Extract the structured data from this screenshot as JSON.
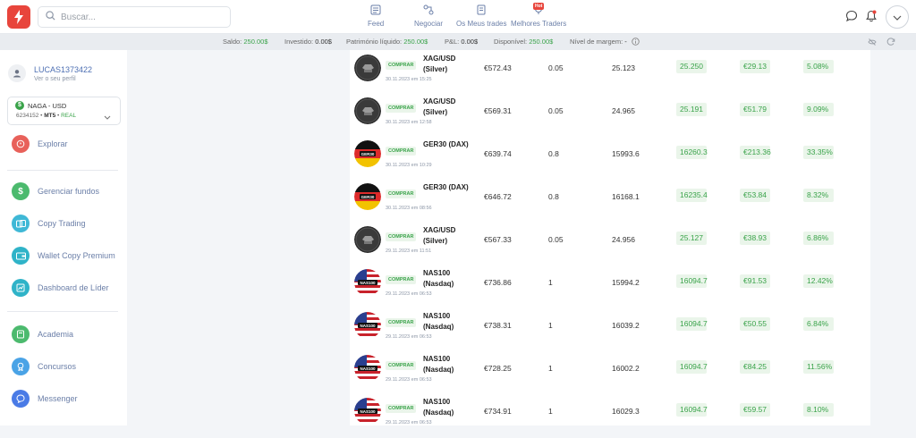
{
  "header": {
    "search_placeholder": "Buscar...",
    "nav": [
      {
        "label": "Feed",
        "icon": "feed-icon"
      },
      {
        "label": "Negociar",
        "icon": "trade-icon"
      },
      {
        "label": "Os Meus trades",
        "icon": "my-trades-icon"
      },
      {
        "label": "Melhores Traders",
        "icon": "trophy-icon",
        "badge": "Hot"
      }
    ]
  },
  "status": {
    "saldo_label": "Saldo:",
    "saldo_value": "250.00$",
    "investido_label": "Investido:",
    "investido_value": "0.00$",
    "patrimonio_label": "Património líquido:",
    "patrimonio_value": "250.00$",
    "pl_label": "P&L:",
    "pl_value": "0.00$",
    "disponivel_label": "Disponível:",
    "disponivel_value": "250.00$",
    "margem_label": "Nível de margem:",
    "margem_value": "-"
  },
  "profile": {
    "username": "LUCAS1373422",
    "sub": "Ver o seu perfil"
  },
  "account": {
    "title": "NAGA - USD",
    "number": "6234152",
    "platform": "MT5",
    "type": "REAL"
  },
  "sidebar": [
    {
      "label": "Explorar",
      "icon": "explore-icon",
      "color": "#e8615a"
    },
    {
      "label": "Gerenciar fundos",
      "icon": "dollar-icon",
      "color": "#4cba6e"
    },
    {
      "label": "Copy Trading",
      "icon": "copy-trading-icon",
      "color": "#3fb8d6"
    },
    {
      "label": "Wallet Copy Premium",
      "icon": "wallet-icon",
      "color": "#2fb3c8"
    },
    {
      "label": "Dashboard de Líder",
      "icon": "dashboard-icon",
      "color": "#2fb3c8"
    },
    {
      "label": "Academia",
      "icon": "academy-icon",
      "color": "#4cba6e"
    },
    {
      "label": "Concursos",
      "icon": "contest-icon",
      "color": "#4aa3e6"
    },
    {
      "label": "Messenger",
      "icon": "messenger-icon",
      "color": "#4a7be6"
    }
  ],
  "trades": [
    {
      "coin": "silver",
      "action": "COMPRAR",
      "instrument": "XAG/USD (Silver)",
      "date": "30.11.2023 em 15:25",
      "amount": "€572.43",
      "lots": "0.05",
      "open": "25.123",
      "current": "25.250",
      "profit": "€29.13",
      "pct": "5.08%"
    },
    {
      "coin": "silver",
      "action": "COMPRAR",
      "instrument": "XAG/USD (Silver)",
      "date": "30.11.2023 em 12:58",
      "amount": "€569.31",
      "lots": "0.05",
      "open": "24.965",
      "current": "25.191",
      "profit": "€51.79",
      "pct": "9.09%"
    },
    {
      "coin": "ger",
      "coin_label": "GER30",
      "action": "COMPRAR",
      "instrument": "GER30 (DAX)",
      "date": "30.11.2023 em 10:29",
      "amount": "€639.74",
      "lots": "0.8",
      "open": "15993.6",
      "current": "16260.3",
      "profit": "€213.36",
      "pct": "33.35%"
    },
    {
      "coin": "ger",
      "coin_label": "GER30",
      "action": "COMPRAR",
      "instrument": "GER30 (DAX)",
      "date": "30.11.2023 em 08:56",
      "amount": "€646.72",
      "lots": "0.8",
      "open": "16168.1",
      "current": "16235.4",
      "profit": "€53.84",
      "pct": "8.32%"
    },
    {
      "coin": "silver",
      "action": "COMPRAR",
      "instrument": "XAG/USD (Silver)",
      "date": "29.11.2023 em 11:51",
      "amount": "€567.33",
      "lots": "0.05",
      "open": "24.956",
      "current": "25.127",
      "profit": "€38.93",
      "pct": "6.86%"
    },
    {
      "coin": "us",
      "coin_label": "NAS100",
      "action": "COMPRAR",
      "instrument": "NAS100 (Nasdaq)",
      "date": "29.11.2023 em 06:53",
      "amount": "€736.86",
      "lots": "1",
      "open": "15994.2",
      "current": "16094.7",
      "profit": "€91.53",
      "pct": "12.42%"
    },
    {
      "coin": "us",
      "coin_label": "NAS100",
      "action": "COMPRAR",
      "instrument": "NAS100 (Nasdaq)",
      "date": "29.11.2023 em 06:53",
      "amount": "€738.31",
      "lots": "1",
      "open": "16039.2",
      "current": "16094.7",
      "profit": "€50.55",
      "pct": "6.84%"
    },
    {
      "coin": "us",
      "coin_label": "NAS100",
      "action": "COMPRAR",
      "instrument": "NAS100 (Nasdaq)",
      "date": "29.11.2023 em 06:53",
      "amount": "€728.25",
      "lots": "1",
      "open": "16002.2",
      "current": "16094.7",
      "profit": "€84.25",
      "pct": "11.56%"
    },
    {
      "coin": "us",
      "coin_label": "NAS100",
      "action": "COMPRAR",
      "instrument": "NAS100 (Nasdaq)",
      "date": "29.11.2023 em 06:53",
      "amount": "€734.91",
      "lots": "1",
      "open": "16029.3",
      "current": "16094.7",
      "profit": "€59.57",
      "pct": "8.10%"
    }
  ]
}
